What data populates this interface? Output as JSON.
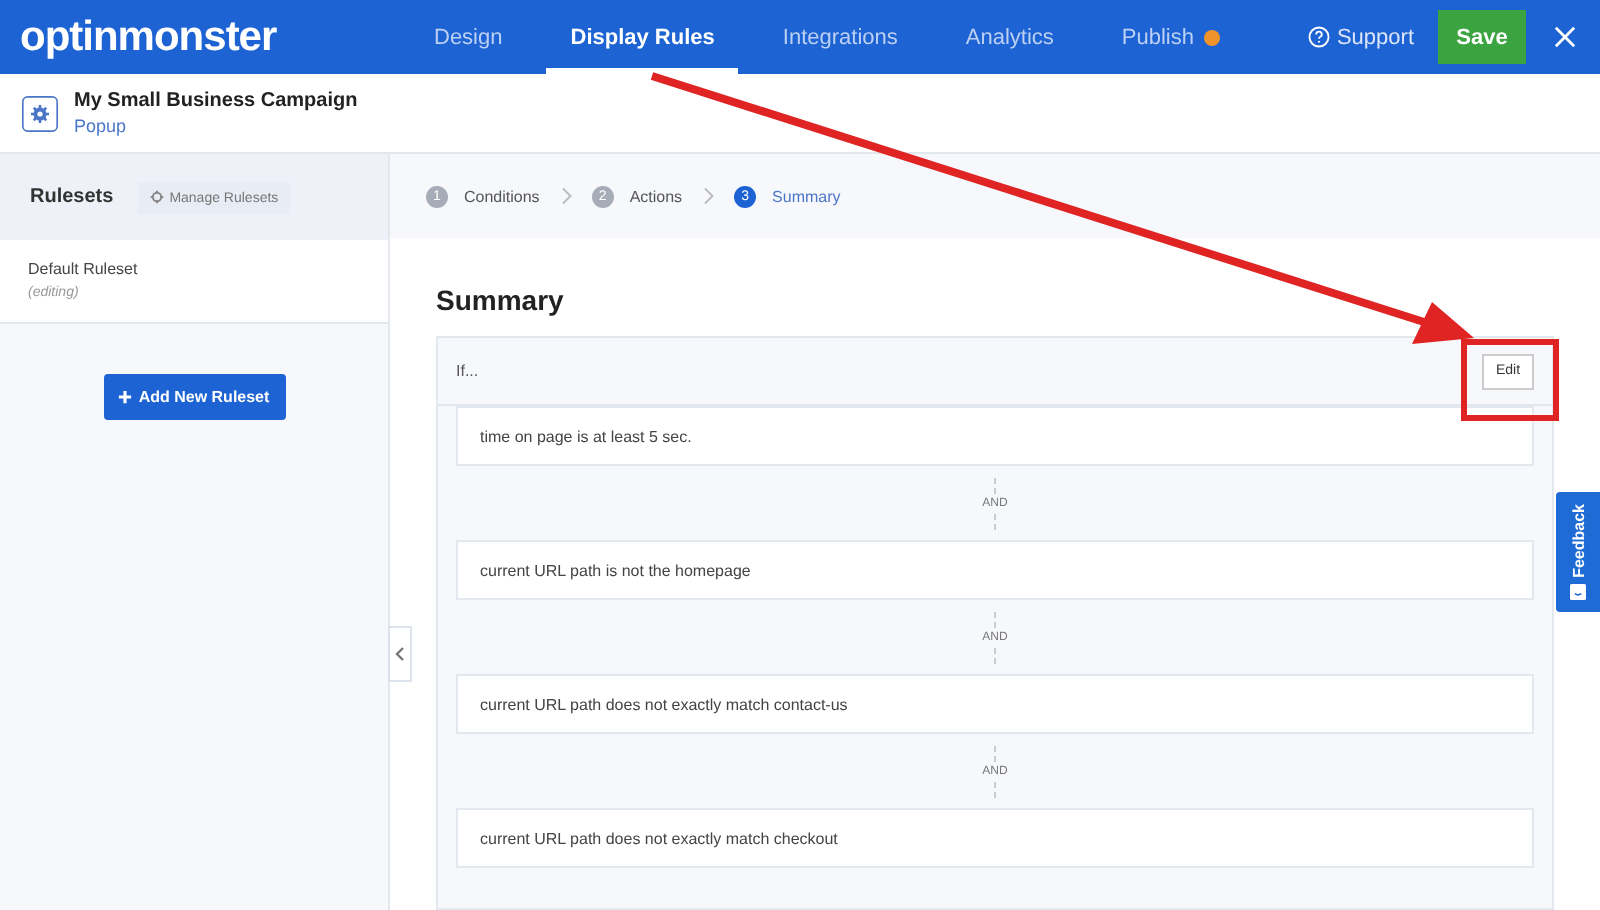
{
  "header": {
    "logo": "optinmonster",
    "tabs": [
      {
        "label": "Design",
        "selected": false
      },
      {
        "label": "Display Rules",
        "selected": true
      },
      {
        "label": "Integrations",
        "selected": false
      },
      {
        "label": "Analytics",
        "selected": false
      },
      {
        "label": "Publish",
        "selected": false,
        "badge": true
      }
    ],
    "support": "Support",
    "save": "Save"
  },
  "campaign": {
    "title": "My Small Business Campaign",
    "type": "Popup"
  },
  "sidebar": {
    "title": "Rulesets",
    "manage": "Manage Rulesets",
    "rulesets": [
      {
        "name": "Default Ruleset",
        "status": "(editing)"
      }
    ],
    "add_button": "Add New Ruleset"
  },
  "steps": [
    {
      "number": "1",
      "label": "Conditions",
      "selected": false
    },
    {
      "number": "2",
      "label": "Actions",
      "selected": false
    },
    {
      "number": "3",
      "label": "Summary",
      "selected": true
    }
  ],
  "summary": {
    "title": "Summary",
    "if_label": "If...",
    "edit": "Edit",
    "rules": [
      {
        "text": "time on page is at least 5 sec."
      },
      {
        "conjunction": "AND",
        "text": "current URL path is not the homepage"
      },
      {
        "conjunction": "AND",
        "text": "current URL path does not exactly match contact-us"
      },
      {
        "conjunction": "AND",
        "text": "current URL path does not exactly match checkout"
      }
    ]
  },
  "feedback": "Feedback"
}
